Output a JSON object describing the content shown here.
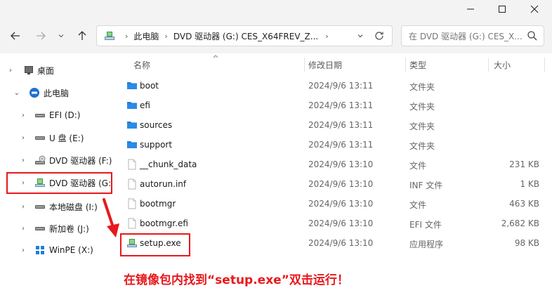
{
  "window": {
    "minimize_icon": "minimize-icon",
    "maximize_icon": "maximize-icon",
    "close_icon": "close-icon"
  },
  "address": {
    "segments": [
      "此电脑",
      "DVD 驱动器 (G:) CES_X64FREV_Z..."
    ],
    "separator": "›"
  },
  "search": {
    "placeholder": "在 DVD 驱动器 (G:) CES_X..."
  },
  "tree": [
    {
      "label": "桌面",
      "icon": "desktop-icon",
      "chevron": "›"
    },
    {
      "label": "此电脑",
      "icon": "this-pc-icon",
      "chevron": "⌄"
    },
    {
      "label": "EFI (D:)",
      "icon": "drive-icon",
      "chevron": "›"
    },
    {
      "label": "U 盘 (E:)",
      "icon": "drive-icon",
      "chevron": "›"
    },
    {
      "label": "DVD 驱动器 (F:)",
      "icon": "dvd-drive-icon",
      "chevron": "›"
    },
    {
      "label": "DVD 驱动器 (G:",
      "icon": "dvd-setup-icon",
      "chevron": "›"
    },
    {
      "label": "本地磁盘 (I:)",
      "icon": "drive-icon",
      "chevron": "›"
    },
    {
      "label": "新加卷 (J:)",
      "icon": "drive-icon",
      "chevron": "›"
    },
    {
      "label": "WinPE (X:)",
      "icon": "winpe-icon",
      "chevron": "›"
    }
  ],
  "columns": {
    "name": "名称",
    "date": "修改日期",
    "type": "类型",
    "size": "大小"
  },
  "files": [
    {
      "name": "boot",
      "date": "2024/9/6 13:11",
      "type": "文件夹",
      "size": "",
      "icon": "folder-icon"
    },
    {
      "name": "efi",
      "date": "2024/9/6 13:11",
      "type": "文件夹",
      "size": "",
      "icon": "folder-icon"
    },
    {
      "name": "sources",
      "date": "2024/9/6 13:11",
      "type": "文件夹",
      "size": "",
      "icon": "folder-icon"
    },
    {
      "name": "support",
      "date": "2024/9/6 13:11",
      "type": "文件夹",
      "size": "",
      "icon": "folder-icon"
    },
    {
      "name": "__chunk_data",
      "date": "2024/9/6 13:10",
      "type": "文件",
      "size": "231 KB",
      "icon": "file-icon"
    },
    {
      "name": "autorun.inf",
      "date": "2024/9/6 13:10",
      "type": "INF 文件",
      "size": "1 KB",
      "icon": "file-icon"
    },
    {
      "name": "bootmgr",
      "date": "2024/9/6 13:10",
      "type": "文件",
      "size": "463 KB",
      "icon": "file-icon"
    },
    {
      "name": "bootmgr.efi",
      "date": "2024/9/6 13:10",
      "type": "EFI 文件",
      "size": "2,682 KB",
      "icon": "file-icon"
    },
    {
      "name": "setup.exe",
      "date": "2024/9/6 13:10",
      "type": "应用程序",
      "size": "98 KB",
      "icon": "setup-app-icon"
    }
  ],
  "annotation": {
    "caption": "在镜像包内找到“setup.exe”双击运行！",
    "color": "#e8181c"
  }
}
